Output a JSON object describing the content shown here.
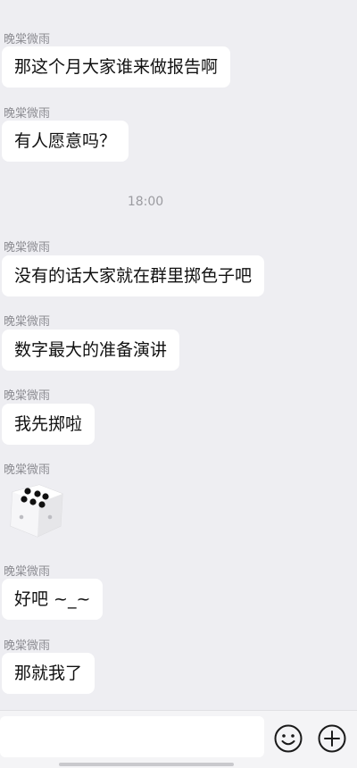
{
  "messages": [
    {
      "sender": "晚棠微雨",
      "text": "那这个月大家谁来做报告啊"
    },
    {
      "sender": "晚棠微雨",
      "text": "有人愿意吗？"
    },
    {
      "sender": "晚棠微雨",
      "text": "没有的话大家就在群里掷色子吧"
    },
    {
      "sender": "晚棠微雨",
      "text": "数字最大的准备演讲"
    },
    {
      "sender": "晚棠微雨",
      "text": "我先掷啦"
    },
    {
      "sender": "晚棠微雨",
      "dice_value": 6
    },
    {
      "sender": "晚棠微雨",
      "text": "好吧 ~_~"
    },
    {
      "sender": "晚棠微雨",
      "text": "那就我了"
    }
  ],
  "timestamp": "18:00",
  "input": {
    "value": "",
    "placeholder": ""
  },
  "icons": {
    "emoji": "smiley-icon",
    "more": "plus-circle-icon"
  },
  "colors": {
    "background": "#eeeef2",
    "bubble": "#ffffff",
    "sender": "#8d8d93"
  }
}
